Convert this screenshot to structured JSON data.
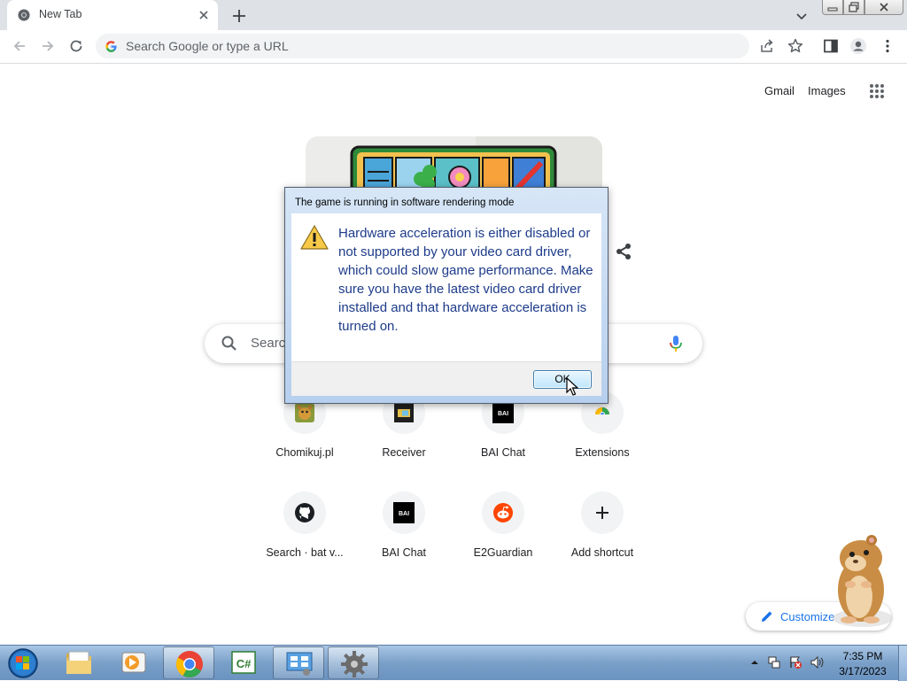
{
  "browser": {
    "tab_title": "New Tab",
    "omnibox_placeholder": "Search Google or type a URL"
  },
  "page": {
    "header_links": [
      "Gmail",
      "Images"
    ],
    "search_placeholder": "Search Google or type a URL",
    "search_visible_text": "Searc",
    "shortcuts": [
      {
        "label": "Chomikuj.pl",
        "icon": "chomikuj-icon"
      },
      {
        "label": "Receiver",
        "icon": "receiver-icon"
      },
      {
        "label": "BAI Chat",
        "icon": "bai-chat-icon"
      },
      {
        "label": "Extensions",
        "icon": "chrome-icon"
      },
      {
        "label": "Search · bat v...",
        "icon": "github-icon"
      },
      {
        "label": "BAI Chat",
        "icon": "bai-chat-icon"
      },
      {
        "label": "E2Guardian",
        "icon": "reddit-icon"
      },
      {
        "label": "Add shortcut",
        "icon": "plus-icon"
      }
    ],
    "bai_icon_text": "BAI",
    "customize_label": "Customize"
  },
  "dialog": {
    "title": "The game is running in software rendering mode",
    "message": "Hardware acceleration is either disabled or not supported by your video card driver, which could slow game performance. Make sure you have the latest video card driver installed and that hardware acceleration is turned on.",
    "ok_label": "OK"
  },
  "taskbar": {
    "apps": [
      "explorer",
      "media-player",
      "chrome",
      "csharp-editor",
      "control-panel",
      "game-gear"
    ],
    "csharp_text": "C#",
    "clock_time": "7:35 PM",
    "clock_date": "3/17/2023"
  },
  "colors": {
    "accent_blue": "#1a73e8",
    "dialog_text": "#1d3b8a"
  }
}
